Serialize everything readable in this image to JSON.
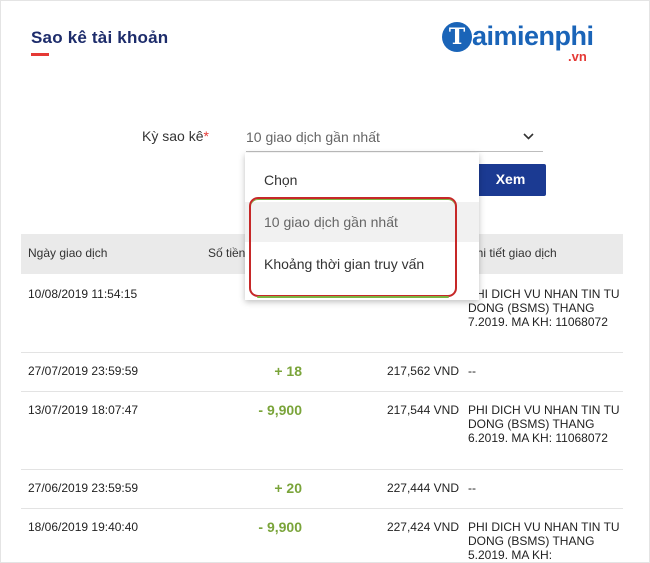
{
  "header": {
    "title": "Sao kê tài khoản",
    "logo_letter": "T",
    "logo_text": "aimienphi",
    "logo_sub": ".vn"
  },
  "filter": {
    "label": "Kỳ sao kê",
    "required_mark": "*",
    "selected": "10 giao dịch gần nhất",
    "view_button": "Xem",
    "options": [
      {
        "label": "Chọn"
      },
      {
        "label": "10 giao dịch gần nhất"
      },
      {
        "label": "Khoảng thời gian truy vấn"
      }
    ]
  },
  "table": {
    "columns": [
      "Ngày giao dịch",
      "Số tiền",
      "Chi tiết giao dịch"
    ],
    "rows": [
      {
        "date": "10/08/2019 11:54:15",
        "amount": "",
        "balance": "",
        "detail": "PHI DICH VU NHAN TIN TU DONG (BSMS) THANG 7.2019. MA KH: 11068072"
      },
      {
        "date": "27/07/2019 23:59:59",
        "amount": "+ 18",
        "balance": "217,562 VND",
        "detail": "--"
      },
      {
        "date": "13/07/2019 18:07:47",
        "amount": "- 9,900",
        "balance": "217,544 VND",
        "detail": "PHI DICH VU NHAN TIN TU DONG (BSMS) THANG 6.2019. MA KH: 11068072"
      },
      {
        "date": "27/06/2019 23:59:59",
        "amount": "+ 20",
        "balance": "227,444 VND",
        "detail": "--"
      },
      {
        "date": "18/06/2019 19:40:40",
        "amount": "- 9,900",
        "balance": "227,424 VND",
        "detail": "PHI DICH VU NHAN TIN TU DONG (BSMS) THANG 5.2019. MA KH:"
      }
    ]
  }
}
